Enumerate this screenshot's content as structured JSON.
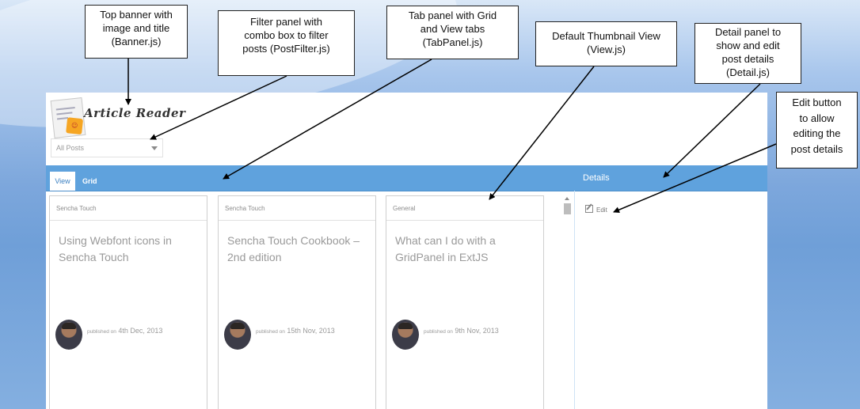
{
  "banner": {
    "title": "Article Reader"
  },
  "filter": {
    "selected": "All Posts"
  },
  "tabs": [
    {
      "label": "View",
      "active": true
    },
    {
      "label": "Grid",
      "active": false
    }
  ],
  "details": {
    "title": "Details",
    "edit_label": "Edit"
  },
  "cards": [
    {
      "category": "Sencha Touch",
      "title": "Using Webfont icons in Sencha Touch",
      "published_prefix": "published on",
      "date": "4th Dec, 2013"
    },
    {
      "category": "Sencha Touch",
      "title": "Sencha Touch Cookbook – 2nd edition",
      "published_prefix": "published on",
      "date": "15th Nov, 2013"
    },
    {
      "category": "General",
      "title": "What can I do with a GridPanel in ExtJS",
      "published_prefix": "published on",
      "date": "9th Nov, 2013"
    }
  ],
  "annotations": [
    {
      "text": "Top banner  with\nimage and title\n(Banner.js)"
    },
    {
      "text": "Filter panel with\ncombo box to filter\nposts (PostFilter.js)"
    },
    {
      "text": "Tab panel with Grid\nand View tabs\n(TabPanel.js)"
    },
    {
      "text": "Default Thumbnail View\n(View.js)"
    },
    {
      "text": "Detail panel to\nshow and edit\npost details\n(Detail.js)"
    },
    {
      "text": "Edit button\nto allow\nediting the\npost details"
    }
  ],
  "colors": {
    "accent": "#5fa2dd",
    "card_border": "#cfcfcf",
    "muted_text": "#9a9a9a"
  }
}
